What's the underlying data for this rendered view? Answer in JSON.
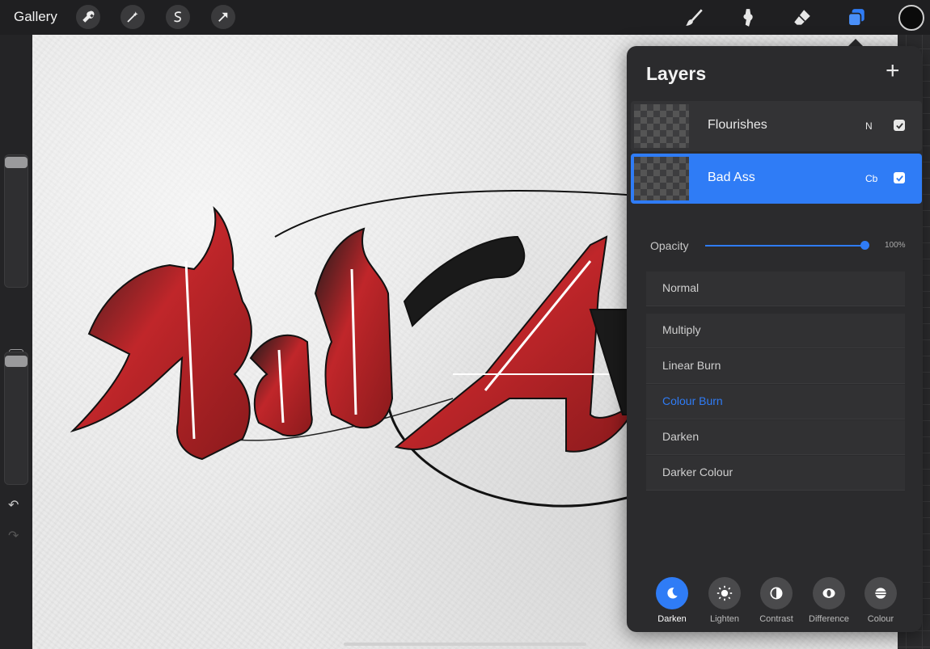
{
  "topbar": {
    "gallery_label": "Gallery",
    "left_tools": [
      "wrench-icon",
      "magic-wand-icon",
      "selection-s-icon",
      "transform-arrow-icon"
    ],
    "right_tools": [
      "brush-icon",
      "smudge-icon",
      "eraser-icon",
      "layers-icon"
    ],
    "color": "#0b0b0b",
    "accent": "#2f7cf6"
  },
  "canvas": {
    "artwork_text": "Bad Ass"
  },
  "layers_panel": {
    "title": "Layers",
    "layers": [
      {
        "name": "Flourishes",
        "blend": "N",
        "visible": true,
        "selected": false
      },
      {
        "name": "Bad Ass",
        "blend": "Cb",
        "visible": true,
        "selected": true
      }
    ],
    "opacity_label": "Opacity",
    "opacity_value": "100%",
    "opacity_fraction": 1.0,
    "blend_modes": [
      {
        "label": "Normal",
        "active": false
      },
      {
        "label": "Multiply",
        "active": false
      },
      {
        "label": "Linear Burn",
        "active": false
      },
      {
        "label": "Colour Burn",
        "active": true
      },
      {
        "label": "Darken",
        "active": false
      },
      {
        "label": "Darker Colour",
        "active": false
      }
    ],
    "categories": [
      {
        "label": "Darken",
        "icon": "moon-icon",
        "active": true
      },
      {
        "label": "Lighten",
        "icon": "sun-icon",
        "active": false
      },
      {
        "label": "Contrast",
        "icon": "half-circle-icon",
        "active": false
      },
      {
        "label": "Difference",
        "icon": "eye-shape-icon",
        "active": false
      },
      {
        "label": "Colour",
        "icon": "striped-circle-icon",
        "active": false
      }
    ]
  }
}
